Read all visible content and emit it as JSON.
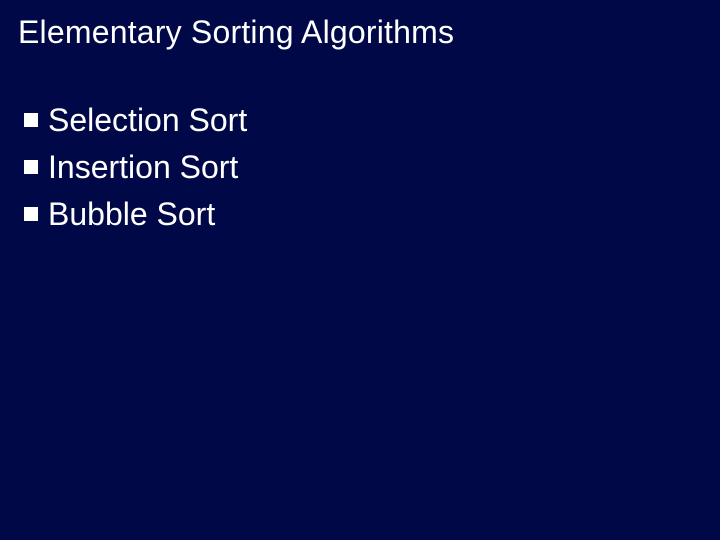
{
  "slide": {
    "title": "Elementary Sorting Algorithms",
    "bullets": [
      {
        "text": "Selection Sort"
      },
      {
        "text": "Insertion Sort"
      },
      {
        "text": "Bubble Sort"
      }
    ]
  }
}
